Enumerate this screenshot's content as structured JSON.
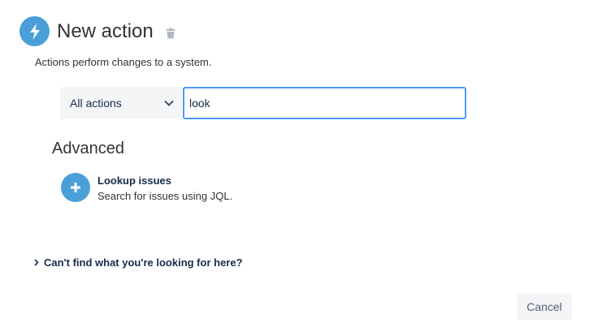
{
  "header": {
    "title": "New action",
    "subtitle": "Actions perform changes to a system.",
    "icon": "lightning-bolt-icon",
    "delete_icon": "trash-icon"
  },
  "filter": {
    "category_selected": "All actions",
    "search_value": "look"
  },
  "results": {
    "section_title": "Advanced",
    "items": [
      {
        "icon": "plus-icon",
        "title": "Lookup issues",
        "description": "Search for issues using JQL."
      }
    ]
  },
  "help": {
    "link_label": "Can't find what you're looking for here?"
  },
  "footer": {
    "cancel_label": "Cancel"
  },
  "colors": {
    "accent": "#4a9fd8",
    "focus_border": "#4c9aff",
    "muted_bg": "#f4f5f7"
  }
}
